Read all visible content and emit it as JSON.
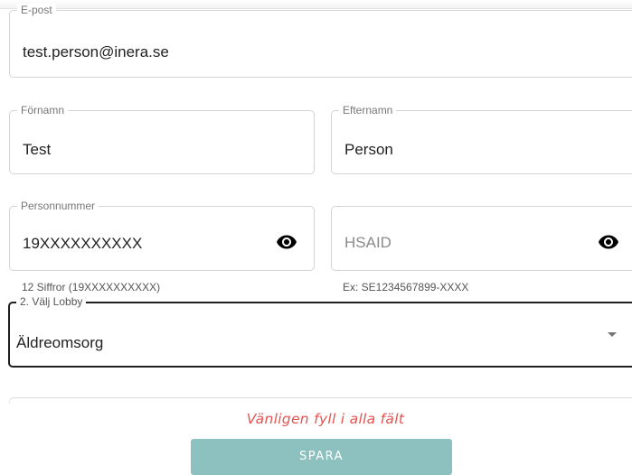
{
  "form": {
    "email": {
      "label": "E-post",
      "value": "test.person@inera.se"
    },
    "first_name": {
      "label": "Förnamn",
      "value": "Test"
    },
    "last_name": {
      "label": "Efternamn",
      "value": "Person"
    },
    "personal_number": {
      "label": "Personnummer",
      "value": "19XXXXXXXXXX",
      "helper": "12 Siffror (19XXXXXXXXXX)",
      "icon": "eye-icon"
    },
    "hsaid": {
      "label": "",
      "placeholder": "HSAID",
      "helper": "Ex: SE1234567899-XXXX",
      "icon": "eye-icon"
    },
    "lobby": {
      "label": "2. Välj Lobby",
      "selected": "Äldreomsorg",
      "icon": "dropdown-arrow-icon"
    }
  },
  "validation_message": "Vänligen fyll i alla fält",
  "save_button": "SPARA",
  "colors": {
    "error": "#e4534f",
    "save_button_bg": "#8cc1bf",
    "focused_border": "#1f1f1f"
  }
}
